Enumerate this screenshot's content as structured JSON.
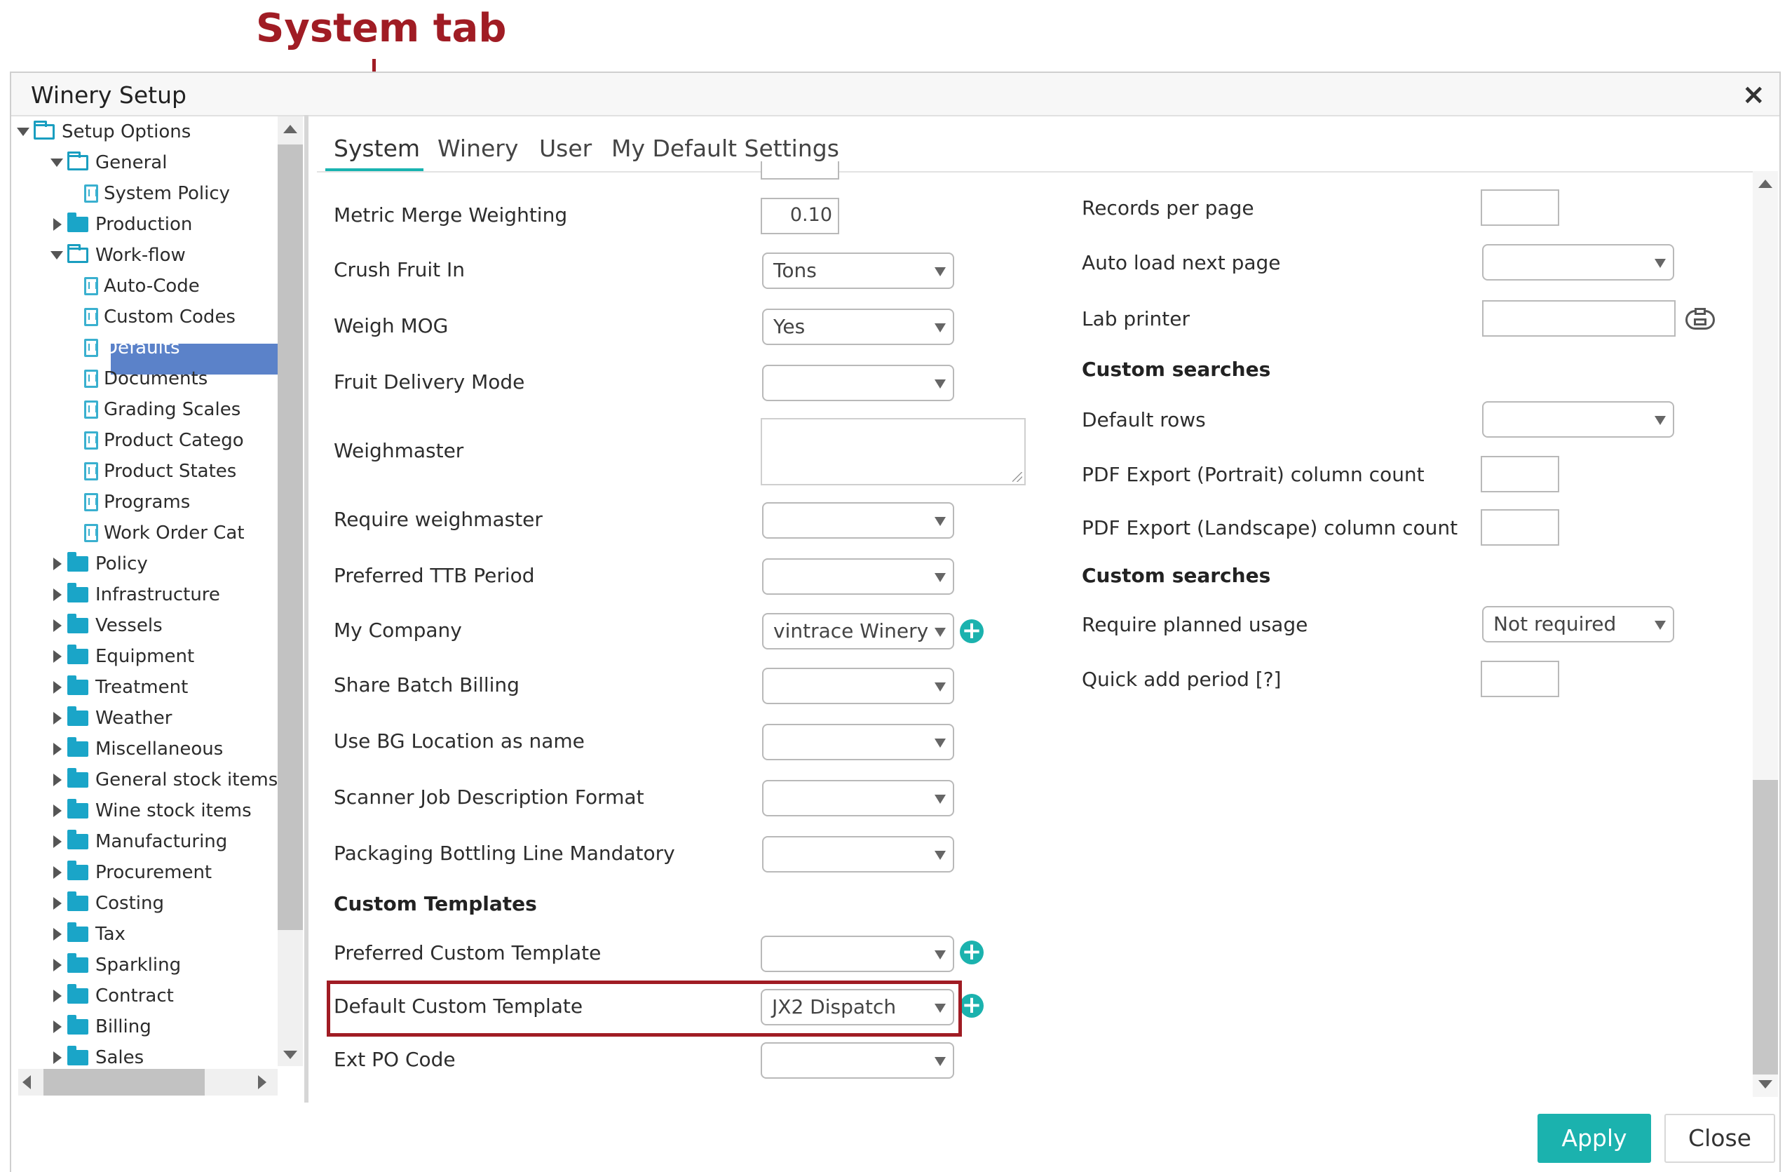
{
  "annotation": {
    "label": "System tab",
    "color": "#a01c24"
  },
  "window": {
    "title": "Winery Setup",
    "close_glyph": "×"
  },
  "tree": {
    "items": [
      {
        "label": "Setup Options",
        "type": "folder-open",
        "expand": "down"
      },
      {
        "label": "General",
        "type": "folder-open",
        "expand": "down"
      },
      {
        "label": "System Policy",
        "type": "doc"
      },
      {
        "label": "Production",
        "type": "folder",
        "expand": "right"
      },
      {
        "label": "Work-flow",
        "type": "folder-open",
        "expand": "down"
      },
      {
        "label": "Auto-Code",
        "type": "doc"
      },
      {
        "label": "Custom Codes",
        "type": "doc"
      },
      {
        "label": "Defaults",
        "type": "doc",
        "selected": true
      },
      {
        "label": "Documents",
        "type": "doc"
      },
      {
        "label": "Grading Scales",
        "type": "doc"
      },
      {
        "label": "Product Catego",
        "type": "doc"
      },
      {
        "label": "Product States",
        "type": "doc"
      },
      {
        "label": "Programs",
        "type": "doc"
      },
      {
        "label": "Work Order Cat",
        "type": "doc"
      },
      {
        "label": "Policy",
        "type": "folder",
        "expand": "right"
      },
      {
        "label": "Infrastructure",
        "type": "folder",
        "expand": "right"
      },
      {
        "label": "Vessels",
        "type": "folder",
        "expand": "right"
      },
      {
        "label": "Equipment",
        "type": "folder",
        "expand": "right"
      },
      {
        "label": "Treatment",
        "type": "folder",
        "expand": "right"
      },
      {
        "label": "Weather",
        "type": "folder",
        "expand": "right"
      },
      {
        "label": "Miscellaneous",
        "type": "folder",
        "expand": "right"
      },
      {
        "label": "General stock items",
        "type": "folder",
        "expand": "right"
      },
      {
        "label": "Wine stock items",
        "type": "folder",
        "expand": "right"
      },
      {
        "label": "Manufacturing",
        "type": "folder",
        "expand": "right"
      },
      {
        "label": "Procurement",
        "type": "folder",
        "expand": "right"
      },
      {
        "label": "Costing",
        "type": "folder",
        "expand": "right"
      },
      {
        "label": "Tax",
        "type": "folder",
        "expand": "right"
      },
      {
        "label": "Sparkling",
        "type": "folder",
        "expand": "right"
      },
      {
        "label": "Contract",
        "type": "folder",
        "expand": "right"
      },
      {
        "label": "Billing",
        "type": "folder",
        "expand": "right"
      },
      {
        "label": "Sales",
        "type": "folder",
        "expand": "right"
      }
    ]
  },
  "tabs": [
    {
      "label": "System",
      "active": true
    },
    {
      "label": "Winery"
    },
    {
      "label": "User"
    },
    {
      "label": "My Default Settings"
    }
  ],
  "left_fields": {
    "metric_merge_weighting": {
      "label": "Metric Merge Weighting",
      "value": "0.10"
    },
    "crush_fruit_in": {
      "label": "Crush Fruit In",
      "value": "Tons"
    },
    "weigh_mog": {
      "label": "Weigh MOG",
      "value": "Yes"
    },
    "fruit_delivery_mode": {
      "label": "Fruit Delivery Mode",
      "value": ""
    },
    "weighmaster": {
      "label": "Weighmaster",
      "value": ""
    },
    "require_weighmaster": {
      "label": "Require weighmaster",
      "value": ""
    },
    "preferred_ttb_period": {
      "label": "Preferred TTB Period",
      "value": ""
    },
    "my_company": {
      "label": "My Company",
      "value": "vintrace Winery"
    },
    "share_batch_billing": {
      "label": "Share Batch Billing",
      "value": ""
    },
    "use_bg_location": {
      "label": "Use BG Location as name",
      "value": ""
    },
    "scanner_job_desc": {
      "label": "Scanner Job Description Format",
      "value": ""
    },
    "packaging_bottling": {
      "label": "Packaging Bottling Line Mandatory",
      "value": ""
    },
    "custom_templates_heading": "Custom Templates",
    "preferred_custom_template": {
      "label": "Preferred Custom Template",
      "value": ""
    },
    "default_custom_template": {
      "label": "Default Custom Template",
      "value": "JX2 Dispatch"
    },
    "ext_po_code": {
      "label": "Ext PO Code",
      "value": ""
    }
  },
  "right_fields": {
    "records_per_page": {
      "label": "Records per page",
      "value": ""
    },
    "auto_load_next_page": {
      "label": "Auto load next page",
      "value": ""
    },
    "lab_printer": {
      "label": "Lab printer",
      "value": ""
    },
    "custom_searches_heading_1": "Custom searches",
    "default_rows": {
      "label": "Default rows",
      "value": ""
    },
    "pdf_export_portrait": {
      "label": "PDF Export (Portrait) column count",
      "value": ""
    },
    "pdf_export_landscape": {
      "label": "PDF Export (Landscape) column count",
      "value": ""
    },
    "custom_searches_heading_2": "Custom searches",
    "require_planned_usage": {
      "label": "Require planned usage",
      "value": "Not required"
    },
    "quick_add_period": {
      "label": "Quick add period [?]",
      "value": ""
    }
  },
  "footer": {
    "apply_label": "Apply",
    "close_label": "Close"
  },
  "colors": {
    "accent": "#1bb2ae",
    "selection": "#5b82c9",
    "folder": "#1aa5c8",
    "highlight": "#a01c24"
  },
  "icons": [
    "close-icon",
    "folder-icon",
    "document-icon",
    "expand-arrow-icon",
    "add-icon",
    "printer-icon",
    "dropdown-arrow-icon"
  ]
}
